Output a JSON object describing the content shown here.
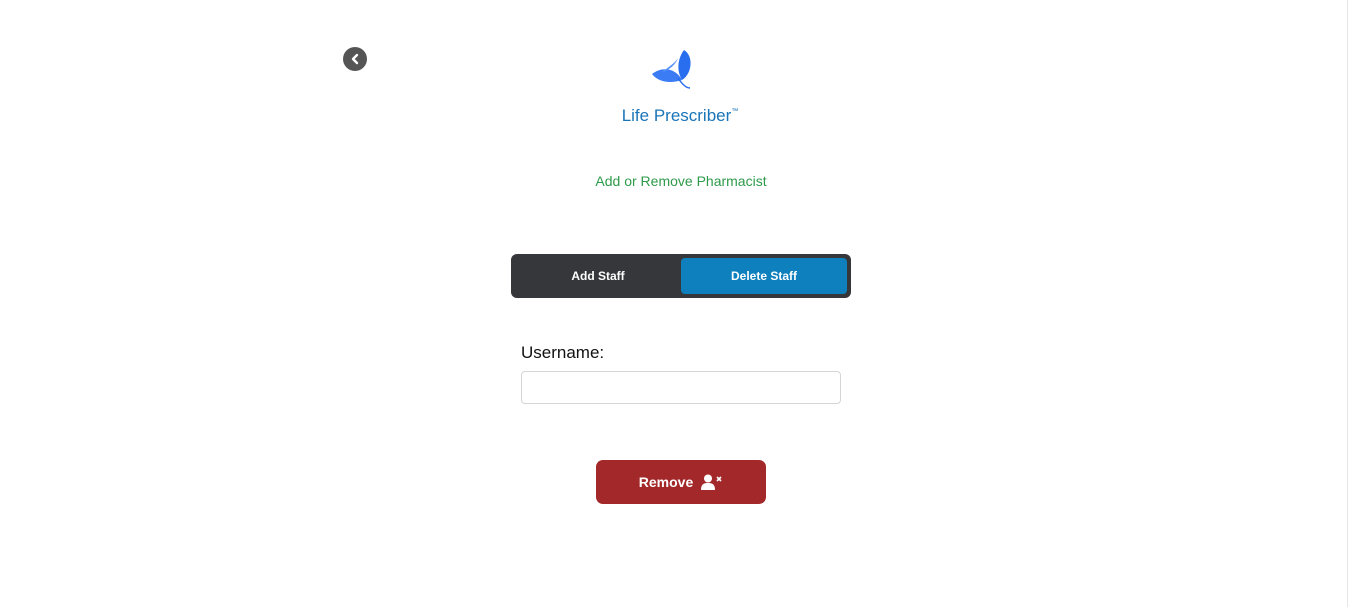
{
  "app": {
    "name": "Life Prescriber",
    "trademark": "™"
  },
  "page": {
    "subtitle": "Add or Remove Pharmacist"
  },
  "toggle": {
    "add_label": "Add Staff",
    "delete_label": "Delete Staff",
    "active": "Delete Staff"
  },
  "form": {
    "username_label": "Username:",
    "username_value": "",
    "remove_label": "Remove"
  },
  "colors": {
    "brand": "#1a75b8",
    "subtitle": "#2e9a4a",
    "active_tab": "#0e80bd",
    "remove": "#a3282a"
  }
}
